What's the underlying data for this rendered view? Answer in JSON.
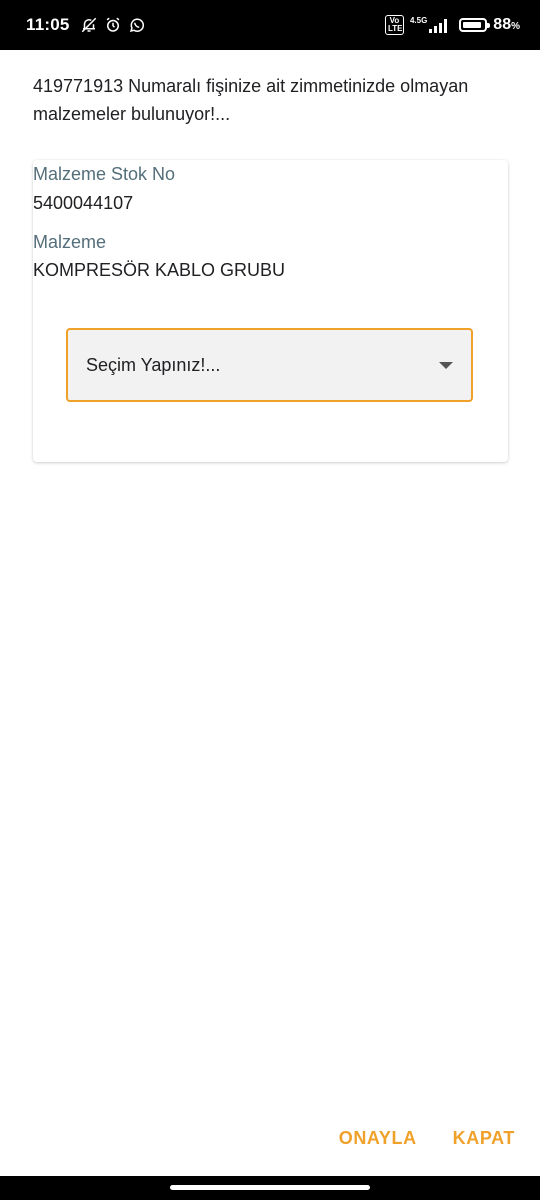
{
  "status_bar": {
    "time": "11:05",
    "left_icons": [
      "bell-off-icon",
      "alarm-icon",
      "whatsapp-icon"
    ],
    "volte": "Vo LTE",
    "network": "4.5G",
    "battery_percent_value": 88,
    "battery_text": "88",
    "battery_unit": "%"
  },
  "dialog": {
    "message": "419771913 Numaralı fişinize ait zimmetinizde olmayan malzemeler bulunuyor!...",
    "card": {
      "stock_no_label": "Malzeme Stok No",
      "stock_no_value": "5400044107",
      "material_label": "Malzeme",
      "material_value": "KOMPRESÖR KABLO GRUBU",
      "select_placeholder": "Seçim Yapınız!..."
    },
    "actions": {
      "confirm": "ONAYLA",
      "close": "KAPAT"
    }
  },
  "colors": {
    "accent": "#f0a12a",
    "label": "#546e7a",
    "text": "#202124",
    "select_bg": "#f2f2f2"
  }
}
